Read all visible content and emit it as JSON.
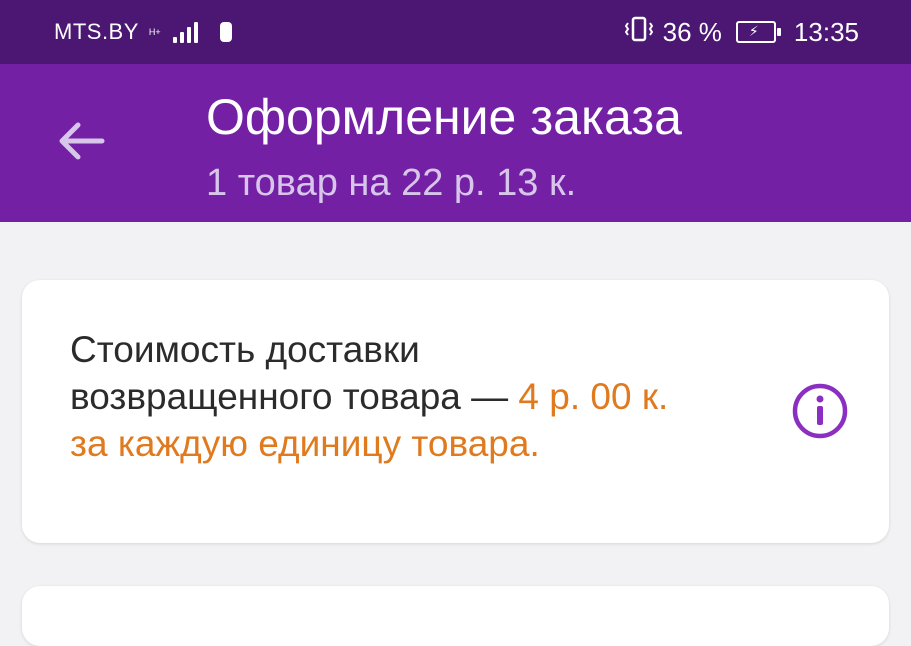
{
  "status_bar": {
    "carrier": "MTS.BY",
    "network_type": "H+",
    "battery_percent": "36 %",
    "time": "13:35"
  },
  "header": {
    "title": "Оформление заказа",
    "subtitle": "1 товар на 22 р. 13 к."
  },
  "info_card": {
    "text_main": "Стоимость доставки возвращенного товара —",
    "text_highlight": "4 р. 00 к. за каждую единицу товара."
  },
  "colors": {
    "status_bar": "#4b1773",
    "header": "#7320a5",
    "highlight": "#e07a1e",
    "icon_accent": "#8a2fc1",
    "background": "#f2f2f4"
  },
  "icons": {
    "back": "arrow-left-icon",
    "info": "info-icon"
  }
}
